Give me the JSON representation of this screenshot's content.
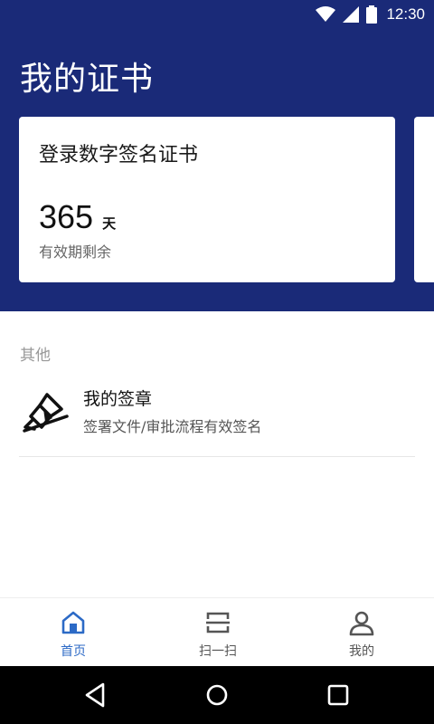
{
  "status_bar": {
    "time": "12:30",
    "icons": [
      "wifi-icon",
      "signal-icon",
      "battery-icon"
    ]
  },
  "header": {
    "title": "我的证书"
  },
  "certificate_card": {
    "title": "登录数字签名证书",
    "days_value": "365",
    "days_unit": "天",
    "days_caption": "有效期剩余"
  },
  "section": {
    "label": "其他"
  },
  "seal_item": {
    "icon": "seal-stamp-icon",
    "title": "我的签章",
    "description": "签署文件/审批流程有效签名"
  },
  "bottom_nav": {
    "items": [
      {
        "label": "首页",
        "icon": "home-icon",
        "active": true
      },
      {
        "label": "扫一扫",
        "icon": "scan-icon",
        "active": false
      },
      {
        "label": "我的",
        "icon": "profile-icon",
        "active": false
      }
    ]
  },
  "colors": {
    "header_bg": "#1a2a78",
    "active_nav": "#2c6ac6",
    "inactive_nav": "#555555"
  },
  "android_nav": {
    "buttons": [
      "back-icon",
      "home-circle-icon",
      "recent-apps-icon"
    ]
  }
}
